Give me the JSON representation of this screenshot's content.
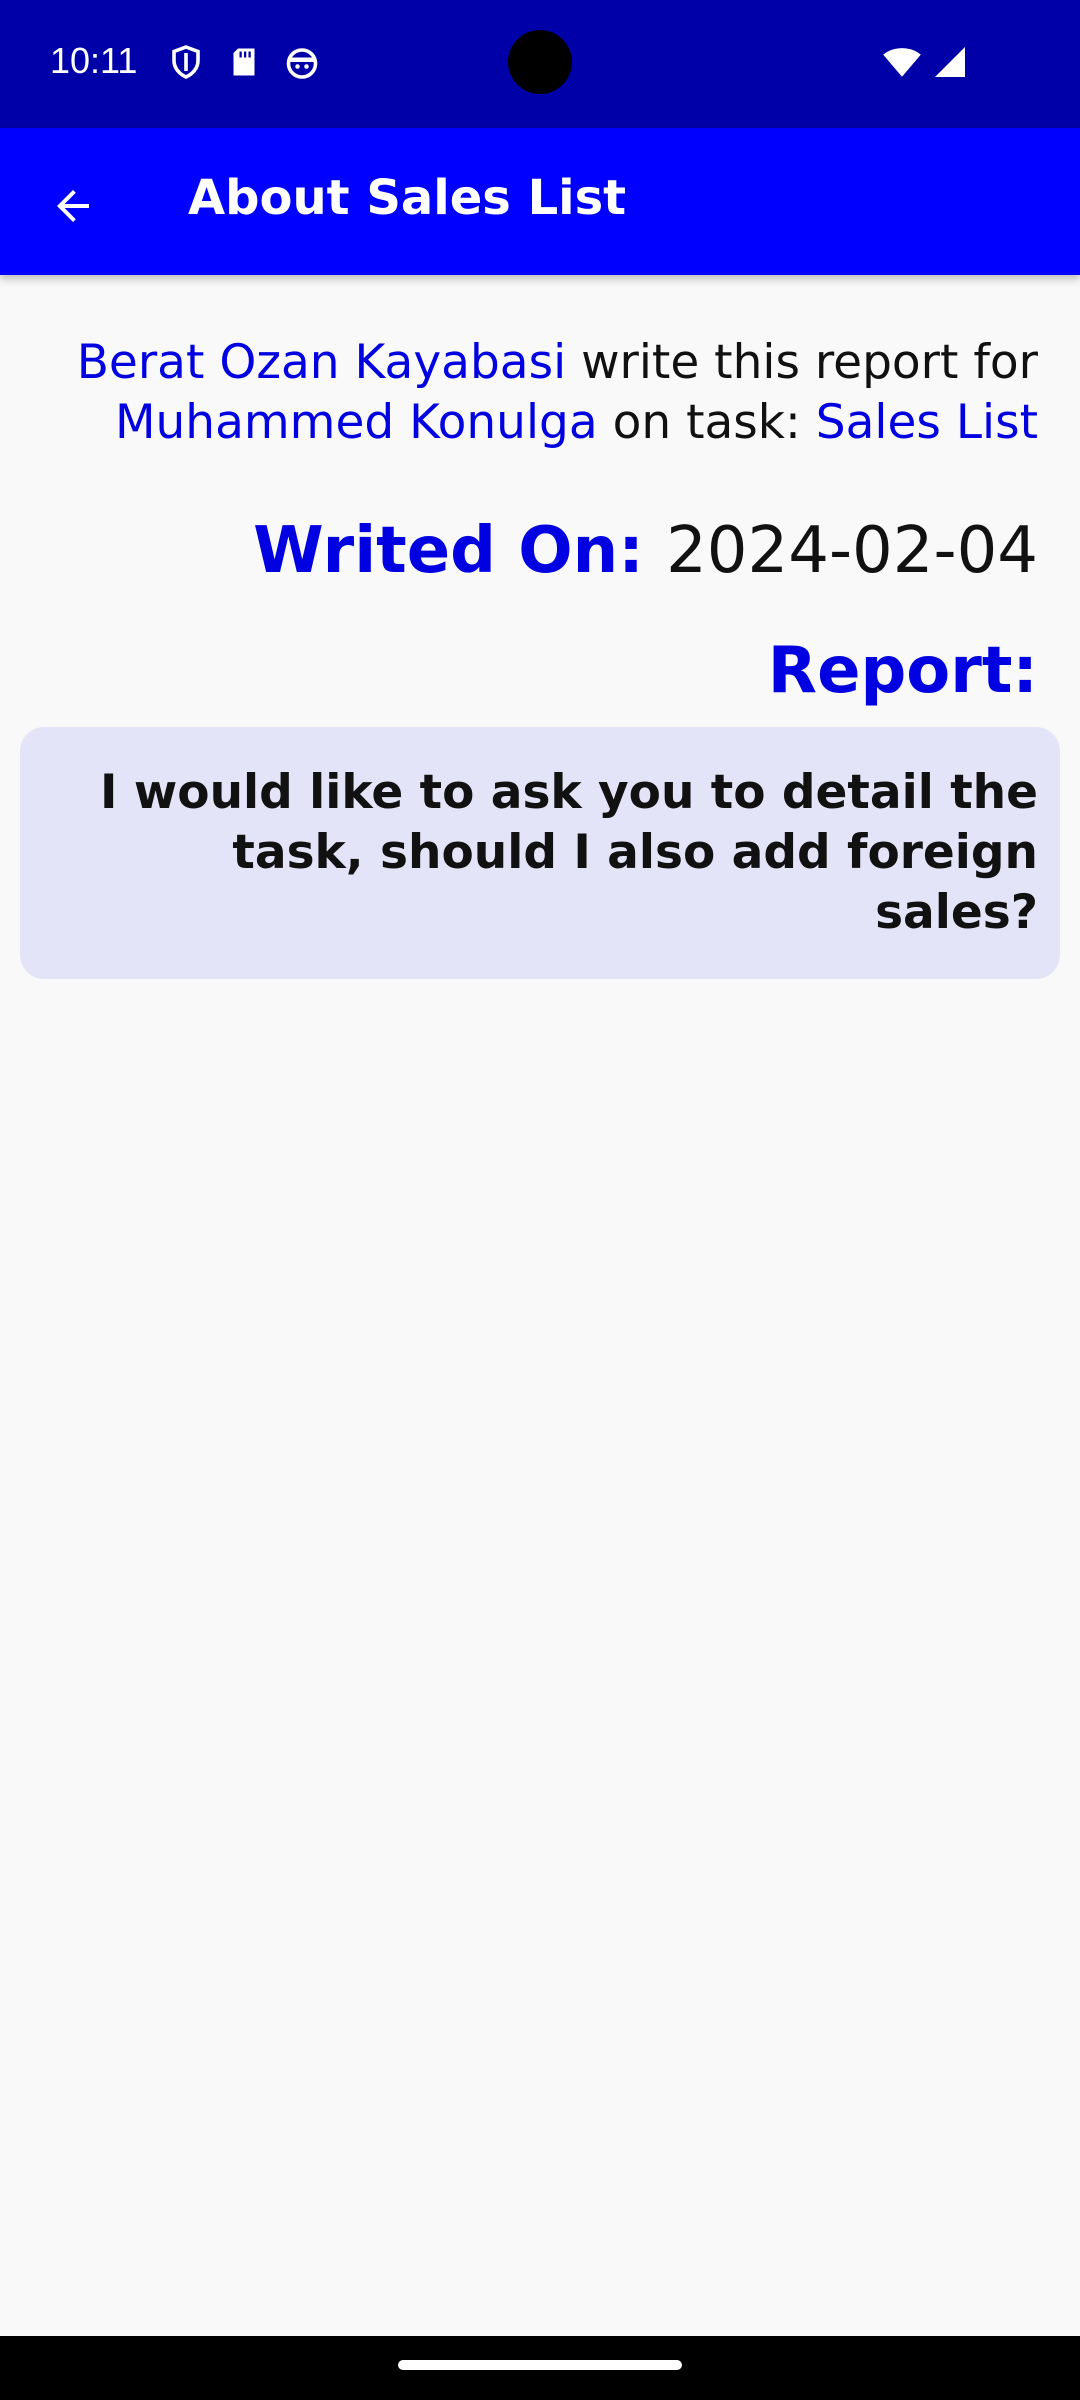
{
  "status_bar": {
    "time": "10:11",
    "icons": [
      "shield-icon",
      "sd-card-icon",
      "android-face-icon",
      "wifi-icon",
      "signal-icon"
    ],
    "background": "#0000a8"
  },
  "app_bar": {
    "title": "About Sales List",
    "back_icon": "arrow-left-icon",
    "background": "#0000ff"
  },
  "report": {
    "author": "Berat Ozan Kayabasi",
    "write_text": " write this report for ",
    "recipient": "Muhammed Konulga",
    "task_text": " on task: ",
    "task": "Sales List",
    "writed_on_label": "Writed On: ",
    "writed_on_value": "2024-02-04",
    "report_label": "Report:",
    "report_body": "I would like to ask you to detail the task, should I also add foreign sales?"
  },
  "colors": {
    "accent": "#0000e0",
    "report_box_bg": "#e4e4f8",
    "page_bg": "#f9f9f9"
  }
}
